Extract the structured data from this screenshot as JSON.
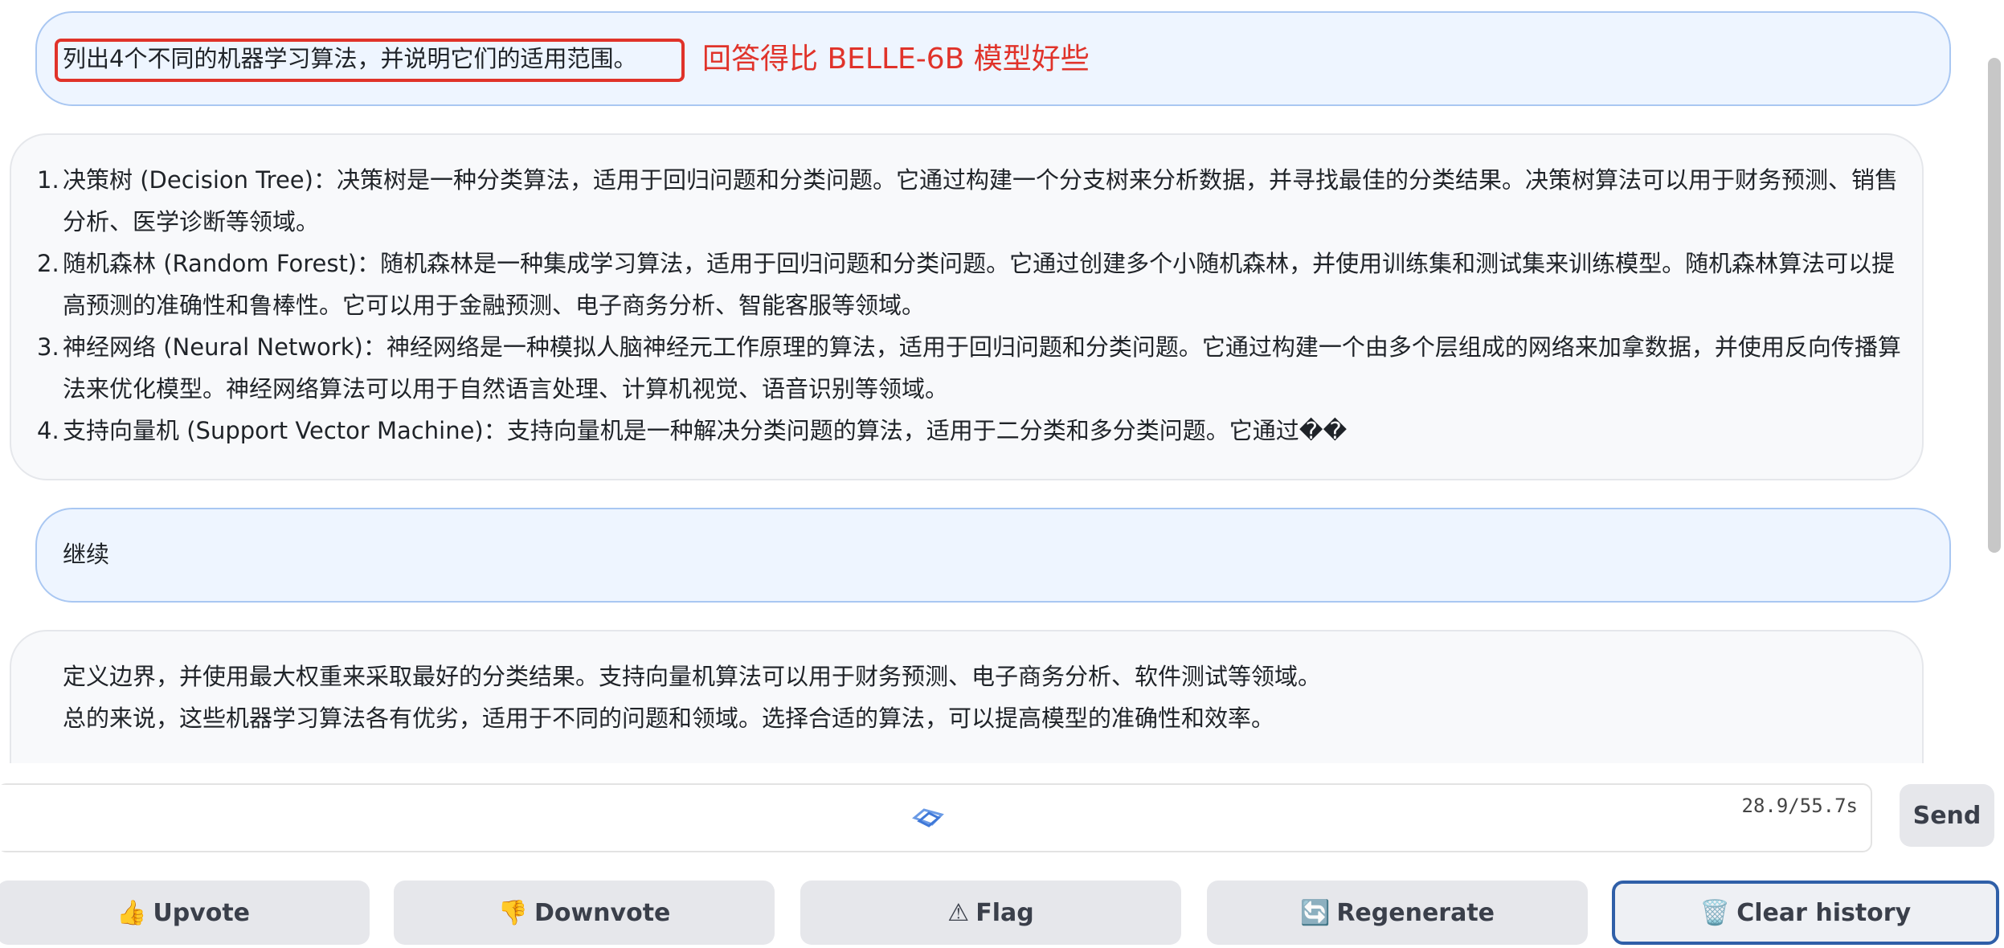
{
  "messages": [
    {
      "role": "user",
      "text": "列出4个不同的机器学习算法，并说明它们的适用范围。",
      "annotation": "回答得比 BELLE-6B 模型好些"
    },
    {
      "role": "assistant",
      "items": [
        {
          "num": "1.",
          "text": "决策树 (Decision Tree)：决策树是一种分类算法，适用于回归问题和分类问题。它通过构建一个分支树来分析数据，并寻找最佳的分类结果。决策树算法可以用于财务预测、销售分析、医学诊断等领域。"
        },
        {
          "num": "2.",
          "text": "随机森林 (Random Forest)：随机森林是一种集成学习算法，适用于回归问题和分类问题。它通过创建多个小随机森林，并使用训练集和测试集来训练模型。随机森林算法可以提高预测的准确性和鲁棒性。它可以用于金融预测、电子商务分析、智能客服等领域。"
        },
        {
          "num": "3.",
          "text": "神经网络 (Neural Network)：神经网络是一种模拟人脑神经元工作原理的算法，适用于回归问题和分类问题。它通过构建一个由多个层组成的网络来加拿数据，并使用反向传播算法来优化模型。神经网络算法可以用于自然语言处理、计算机视觉、语音识别等领域。"
        },
        {
          "num": "4.",
          "text": "支持向量机 (Support Vector Machine)：支持向量机是一种解决分类问题的算法，适用于二分类和多分类问题。它通过��"
        }
      ]
    },
    {
      "role": "user",
      "text": "继续"
    },
    {
      "role": "assistant",
      "lines": [
        "定义边界，并使用最大权重来采取最好的分类结果。支持向量机算法可以用于财务预测、电子商务分析、软件测试等领域。",
        "总的来说，这些机器学习算法各有优劣，适用于不同的问题和领域。选择合适的算法，可以提高模型的准确性和效率。"
      ]
    }
  ],
  "input": {
    "value": "",
    "placeholder": "",
    "timer": "28.9/55.7s"
  },
  "send": {
    "label": "Send"
  },
  "actions": [
    {
      "icon": "👍",
      "label": "Upvote"
    },
    {
      "icon": "👎",
      "label": "Downvote"
    },
    {
      "icon": "⚠",
      "label": "Flag"
    },
    {
      "icon": "🔄",
      "label": "Regenerate"
    },
    {
      "icon": "🗑️",
      "label": "Clear history"
    }
  ],
  "colors": {
    "accent": "#e0332a",
    "user_bubble": "#eef5ff",
    "selected_border": "#2f5fa8"
  }
}
